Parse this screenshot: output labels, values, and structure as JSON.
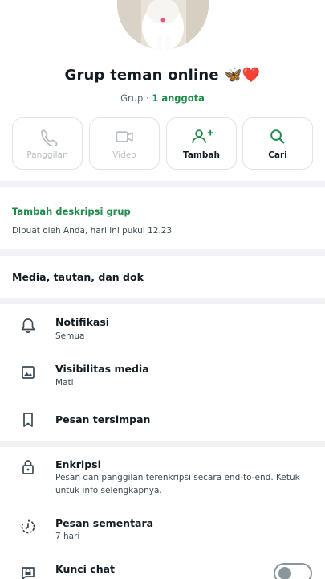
{
  "header": {
    "group_name": "Grup teman online 🦋❤️",
    "group_type": "Grup",
    "separator": "·",
    "member_count": "1 anggota"
  },
  "actions": [
    {
      "label": "Panggilan",
      "icon": "phone-icon",
      "enabled": false
    },
    {
      "label": "Video",
      "icon": "video-camera-icon",
      "enabled": false
    },
    {
      "label": "Tambah",
      "icon": "add-person-icon",
      "enabled": true
    },
    {
      "label": "Cari",
      "icon": "search-icon",
      "enabled": true
    }
  ],
  "description": {
    "add_link": "Tambah deskripsi grup",
    "created_by": "Dibuat oleh Anda, hari ini pukul 12.23"
  },
  "media": {
    "label": "Media, tautan, dan dok"
  },
  "settings": [
    {
      "title": "Notifikasi",
      "subtitle": "Semua",
      "icon": "bell-icon"
    },
    {
      "title": "Visibilitas media",
      "subtitle": "Mati",
      "icon": "image-icon"
    },
    {
      "title": "Pesan tersimpan",
      "subtitle": "",
      "icon": "bookmark-icon"
    }
  ],
  "privacy": [
    {
      "title": "Enkripsi",
      "subtitle": "Pesan dan panggilan terenkripsi secara end-to-end. Ketuk untuk info selengkapnya.",
      "icon": "lock-icon"
    },
    {
      "title": "Pesan sementara",
      "subtitle": "7 hari",
      "icon": "timer-icon"
    },
    {
      "title": "Kunci chat",
      "subtitle": "",
      "icon": "chat-lock-icon",
      "toggle": "off"
    }
  ],
  "colors": {
    "accent": "#1f8a4c",
    "disabled": "#b7bfc4",
    "divider": "#f0f2f5"
  }
}
